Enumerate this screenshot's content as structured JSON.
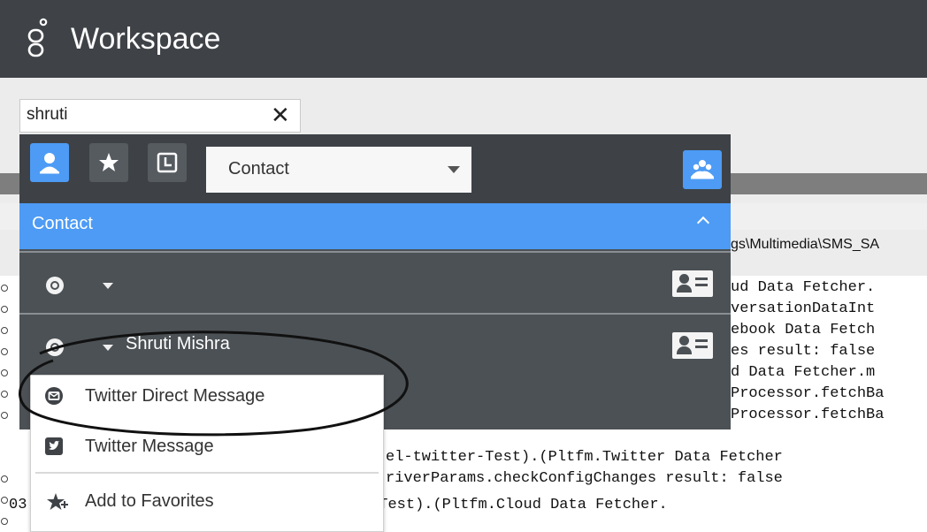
{
  "app": {
    "title": "Workspace"
  },
  "search": {
    "value": "shruti"
  },
  "toolbar": {
    "contact_icon": "person-icon",
    "favorites_icon": "star-icon",
    "recent_icon": "clock-icon",
    "type_select": "Contact",
    "team_icon": "group-icon"
  },
  "section": {
    "title": "Contact"
  },
  "contacts": [
    {
      "name": ""
    },
    {
      "name": "Shruti Mishra"
    }
  ],
  "menu": {
    "items": [
      {
        "label": "Twitter Direct Message",
        "icon": "twitter-dm-icon"
      },
      {
        "label": "Twitter Message",
        "icon": "twitter-icon"
      },
      {
        "label": "Add to Favorites",
        "icon": "star-add-icon"
      }
    ]
  },
  "background": {
    "path": "gs\\Multimedia\\SMS_SA",
    "log_lines": [
      "ud Data Fetcher.",
      "versationDataInt",
      "ebook Data Fetch",
      "es result: false",
      "d Data Fetcher.m",
      "Processor.fetchBa",
      "Processor.fetchBa",
      "el-twitter-Test).(Pltfm.Twitter Data Fetcher",
      "riverParams.checkConfigChanges result: false",
      "03:44:35.449 Tid 42234 (enchnel-facebook-Test).(Pltfm.Cloud Data Fetcher."
    ]
  },
  "colors": {
    "header_bg": "#3f4347",
    "accent": "#4d9bf5",
    "panel_bg": "#4c5155"
  }
}
